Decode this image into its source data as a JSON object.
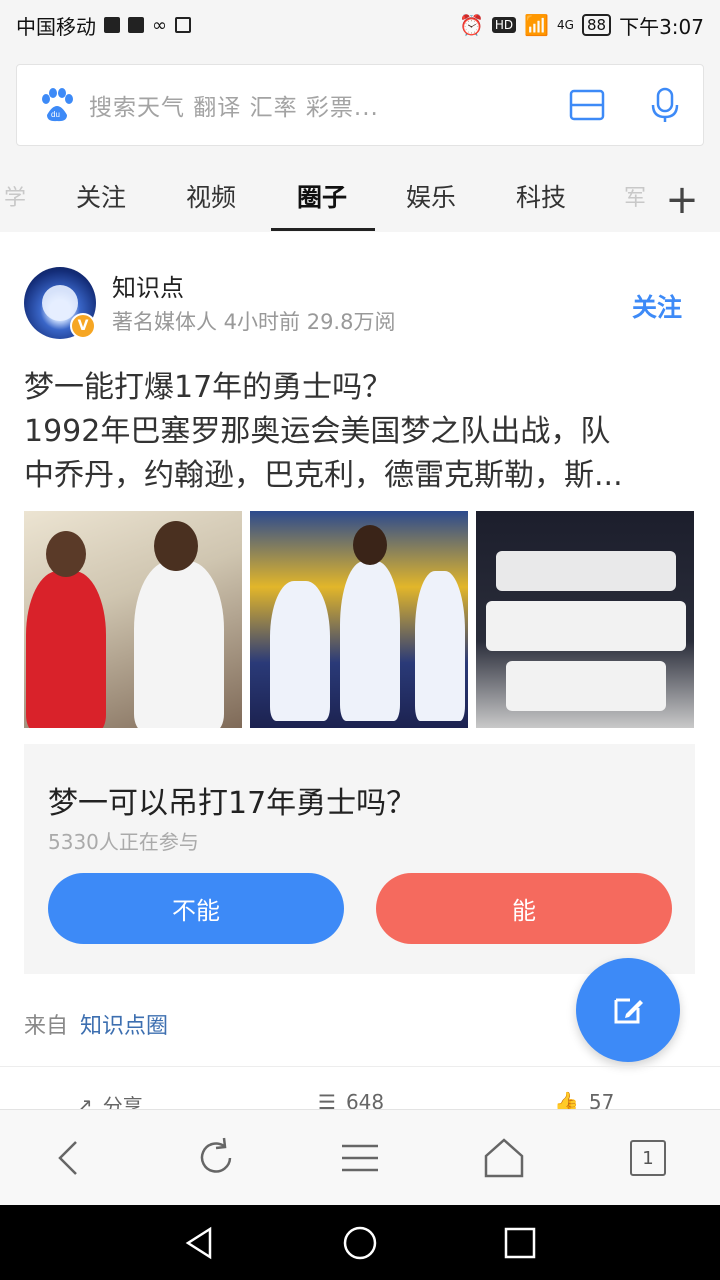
{
  "status_bar": {
    "carrier": "中国移动",
    "network": "4G",
    "battery": "88",
    "time": "下午3:07"
  },
  "search": {
    "placeholder": "搜索天气 翻译 汇率 彩票..."
  },
  "tabs": [
    {
      "label": "关注"
    },
    {
      "label": "视频"
    },
    {
      "label": "圈子",
      "active": true
    },
    {
      "label": "娱乐"
    },
    {
      "label": "科技"
    }
  ],
  "post": {
    "author": "知识点",
    "author_meta": "著名媒体人 4小时前 29.8万阅",
    "follow_label": "关注",
    "text_line1": "梦一能打爆17年的勇士吗？",
    "text_line2": "1992年巴塞罗那奥运会美国梦之队出战，队",
    "text_line3": "中乔丹，约翰逊，巴克利，德雷克斯勒，斯...",
    "poll": {
      "question": "梦一可以吊打17年勇士吗？",
      "participants": "5330人正在参与",
      "option_no": "不能",
      "option_yes": "能"
    },
    "from_label": "来自",
    "from_circle": "知识点圈",
    "actions": {
      "share": "分享",
      "comments": "648",
      "likes": "57"
    }
  },
  "bottom_nav": {
    "tab_count": "1"
  },
  "colors": {
    "accent_blue": "#3d8af7",
    "accent_red": "#f56a5e",
    "link_blue": "#3d6fb0"
  }
}
